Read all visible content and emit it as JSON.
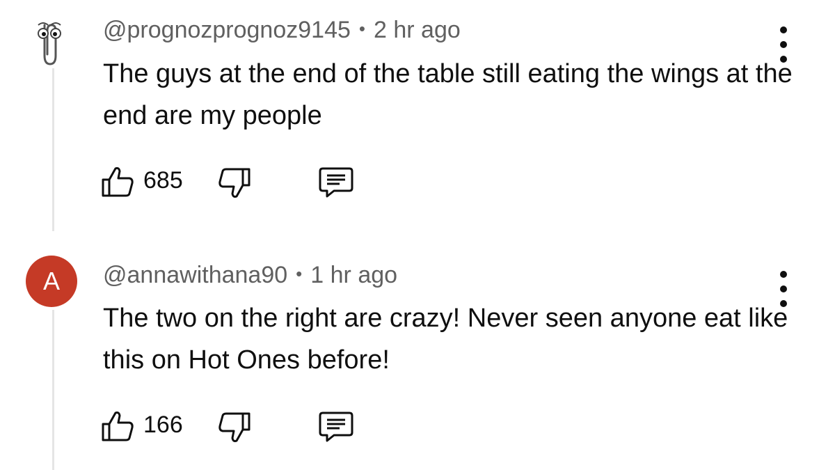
{
  "comments": [
    {
      "avatar_icon": "paperclip-icon",
      "handle": "@prognozprognoz9145",
      "separator": "•",
      "time": "2 hr ago",
      "text": "The guys at the end of the table still eating the wings at the end are my people",
      "likes": "685"
    },
    {
      "avatar_letter": "A",
      "avatar_color": "#c53a26",
      "handle": "@annawithana90",
      "separator": "•",
      "time": "1 hr ago",
      "text": "The two on the right are crazy! Never seen anyone eat like this on Hot Ones before!",
      "likes": "166"
    }
  ]
}
